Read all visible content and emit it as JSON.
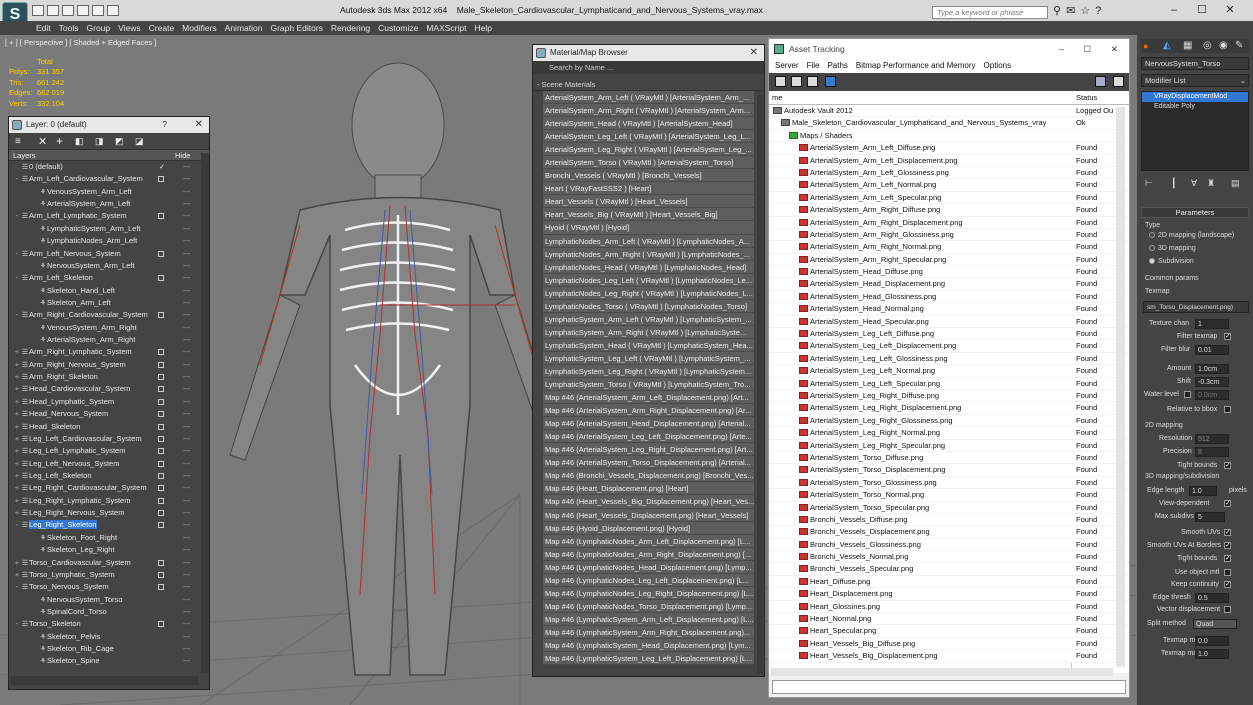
{
  "window": {
    "app_title": "Autodesk 3ds Max  2012 x64",
    "file_title": "Male_Skeleton_Cardiovascular_Lymphaticand_and_Nervous_Systems_vray.max",
    "search_placeholder": "Type a keyword or phrase",
    "logo_letter": "S"
  },
  "menu": [
    "Edit",
    "Tools",
    "Group",
    "Views",
    "Create",
    "Modifiers",
    "Animation",
    "Graph Editors",
    "Rendering",
    "Customize",
    "MAXScript",
    "Help"
  ],
  "viewport": {
    "label": "[ + ] [ Perspective ] [ Shaded + Edged Faces ]",
    "stats_header": "Total",
    "stats": [
      {
        "label": "Polys:",
        "value": "331 357"
      },
      {
        "label": "Tris:",
        "value": "661 242"
      },
      {
        "label": "Edges:",
        "value": "662 019"
      },
      {
        "label": "Verts:",
        "value": "332 104"
      }
    ]
  },
  "layer_panel": {
    "title": "Layer: 0 (default)",
    "help": "?",
    "col_layers": "Layers",
    "col_hide": "Hide",
    "rows": [
      {
        "label": "0 (default)",
        "indent": 0,
        "check": true,
        "box": false,
        "sel": false,
        "exp": ""
      },
      {
        "label": "Arm_Left_Cardiovascular_System",
        "indent": 0,
        "box": true,
        "exp": "-"
      },
      {
        "label": "VenousSystem_Arm_Left",
        "indent": 1
      },
      {
        "label": "ArterialSystem_Arm_Left",
        "indent": 1
      },
      {
        "label": "Arm_Left_Lymphatic_System",
        "indent": 0,
        "box": true,
        "exp": "-"
      },
      {
        "label": "LymphaticSystem_Arm_Left",
        "indent": 1
      },
      {
        "label": "LymphaticNodes_Arm_Left",
        "indent": 1
      },
      {
        "label": "Arm_Left_Nervous_System",
        "indent": 0,
        "box": true,
        "exp": "-"
      },
      {
        "label": "NervousSystem_Arm_Left",
        "indent": 1
      },
      {
        "label": "Arm_Left_Skeleton",
        "indent": 0,
        "box": true,
        "exp": "-"
      },
      {
        "label": "Skeleton_Hand_Left",
        "indent": 1
      },
      {
        "label": "Skeleton_Arm_Left",
        "indent": 1
      },
      {
        "label": "Arm_Right_Cardiovascular_System",
        "indent": 0,
        "box": true,
        "exp": "-"
      },
      {
        "label": "VenousSystem_Arm_Right",
        "indent": 1
      },
      {
        "label": "ArterialSystem_Arm_Right",
        "indent": 1
      },
      {
        "label": "Arm_Right_Lymphatic_System",
        "indent": 0,
        "box": true,
        "exp": "+"
      },
      {
        "label": "Arm_Right_Nervous_System",
        "indent": 0,
        "box": true,
        "exp": "+"
      },
      {
        "label": "Arm_Right_Skeleton",
        "indent": 0,
        "box": true,
        "exp": "+"
      },
      {
        "label": "Head_Cardiovascular_System",
        "indent": 0,
        "box": true,
        "exp": "+"
      },
      {
        "label": "Head_Lymphatic_System",
        "indent": 0,
        "box": true,
        "exp": "+"
      },
      {
        "label": "Head_Nervous_System",
        "indent": 0,
        "box": true,
        "exp": "+"
      },
      {
        "label": "Head_Skeleton",
        "indent": 0,
        "box": true,
        "exp": "+"
      },
      {
        "label": "Leg_Left_Cardiovascular_System",
        "indent": 0,
        "box": true,
        "exp": "+"
      },
      {
        "label": "Leg_Left_Lymphatic_System",
        "indent": 0,
        "box": true,
        "exp": "+"
      },
      {
        "label": "Leg_Left_Nervous_System",
        "indent": 0,
        "box": true,
        "exp": "+"
      },
      {
        "label": "Leg_Left_Skeleton",
        "indent": 0,
        "box": true,
        "exp": "+"
      },
      {
        "label": "Leg_Right_Cardiovascular_System",
        "indent": 0,
        "box": true,
        "exp": "+"
      },
      {
        "label": "Leg_Right_Lymphatic_System",
        "indent": 0,
        "box": true,
        "exp": "+"
      },
      {
        "label": "Leg_Right_Nervous_System",
        "indent": 0,
        "box": true,
        "exp": "+"
      },
      {
        "label": "Leg_Right_Skeleton",
        "indent": 0,
        "box": true,
        "exp": "-",
        "sel": true
      },
      {
        "label": "Skeleton_Foot_Right",
        "indent": 1
      },
      {
        "label": "Skeleton_Leg_Right",
        "indent": 1
      },
      {
        "label": "Torso_Cardiovascular_System",
        "indent": 0,
        "box": true,
        "exp": "+"
      },
      {
        "label": "Torso_Lymphatic_System",
        "indent": 0,
        "box": true,
        "exp": "+"
      },
      {
        "label": "Torso_Nervous_System",
        "indent": 0,
        "box": true,
        "exp": "-"
      },
      {
        "label": "NervousSystem_Torso",
        "indent": 1
      },
      {
        "label": "SpinalCord_Torso",
        "indent": 1
      },
      {
        "label": "Torso_Skeleton",
        "indent": 0,
        "box": true,
        "exp": "-"
      },
      {
        "label": "Skeleton_Pelvis",
        "indent": 1
      },
      {
        "label": "Skeleton_Rib_Cage",
        "indent": 1
      },
      {
        "label": "Skeleton_Spine",
        "indent": 1
      }
    ]
  },
  "material_browser": {
    "title": "Material/Map Browser",
    "search_placeholder": "Search by Name ...",
    "section": "- Scene Materials",
    "items": [
      "ArterialSystem_Arm_Left  ( VRayMtl ) [ArterialSystem_Arm_...",
      "ArterialSystem_Arm_Right  ( VRayMtl ) [ArterialSystem_Arm...",
      "ArterialSystem_Head  ( VRayMtl ) [ArterialSystem_Head]",
      "ArterialSystem_Leg_Left  ( VRayMtl ) [ArterialSystem_Leg_L...",
      "ArterialSystem_Leg_Right  ( VRayMtl ) [ArterialSystem_Leg_...",
      "ArterialSystem_Torso  ( VRayMtl ) [ArterialSystem_Torso]",
      "Bronchi_Vessels  ( VRayMtl ) [Bronchi_Vessels]",
      "Heart  ( VRayFastSSS2 ) [Heart]",
      "Heart_Vessels  ( VRayMtl ) [Heart_Vessels]",
      "Heart_Vessels_Big  ( VRayMtl ) [Heart_Vessels_Big]",
      "Hyoid  ( VRayMtl ) [Hyoid]",
      "LymphaticNodes_Arm_Left  ( VRayMtl ) [LymphaticNodes_A...",
      "LymphaticNodes_Arm_Right  ( VRayMtl ) [LymphaticNodes_...",
      "LymphaticNodes_Head  ( VRayMtl ) [LymphaticNodes_Head]",
      "LymphaticNodes_Leg_Left  ( VRayMtl ) [LymphaticNodes_Le...",
      "LymphaticNodes_Leg_Right  ( VRayMtl ) [LymphaticNodes_L...",
      "LymphaticNodes_Torso  ( VRayMtl ) [LymphaticNodes_Torso]",
      "LymphaticSystem_Arm_Left  ( VRayMtl ) [LymphaticSystem_...",
      "LymphaticSystem_Arm_Right  ( VRayMtl ) [LymphaticSyste...",
      "LymphaticSystem_Head  ( VRayMtl ) [LymphaticSystem_Hea...",
      "LymphaticSystem_Leg_Left  ( VRayMtl ) [LymphaticSystem_...",
      "LymphaticSystem_Leg_Right  ( VRayMtl ) [LymphaticSystem...",
      "LymphaticSystem_Torso  ( VRayMtl ) [LymphaticSystem_Tro...",
      "Map #46 (ArterialSystem_Arm_Left_Displacement.png) [Art...",
      "Map #46 (ArterialSystem_Arm_Right_Displacement.png) [Ar...",
      "Map #46 (ArterialSystem_Head_Displacement.png) [Arterial...",
      "Map #46 (ArterialSystem_Leg_Left_Displacement.png) [Arte...",
      "Map #46 (ArterialSystem_Leg_Right_Displacement.png) [Art...",
      "Map #46 (ArterialSystem_Torso_Displacement.png) [Arterial...",
      "Map #46 (Bronchi_Vessels_Displacement.png) [Bronchi_Ves...",
      "Map #46 (Heart_Displacement.png) [Heart]",
      "Map #46 (Heart_Vessels_Big_Displacement.png) [Heart_Ves...",
      "Map #46 (Heart_Vessels_Displacement.png) [Heart_Vessels]",
      "Map #46 (Hyoid_Displacement.png) [Hyoid]",
      "Map #46 (LymphaticNodes_Arm_Left_Displacement.png) [L...",
      "Map #46 (LymphaticNodes_Arm_Right_Displacement.png) [...",
      "Map #46 (LymphaticNodes_Head_Displacement.png) [Lymp...",
      "Map #46 (LymphaticNodes_Leg_Left_Displacement.png) [L...",
      "Map #46 (LymphaticNodes_Leg_Right_Displacement.png) [L...",
      "Map #46 (LymphaticNodes_Torso_Displacement.png) [Lymp...",
      "Map #46 (LymphaticSystem_Arm_Left_Displacement.png) [L...",
      "Map #46 (LymphaticSystem_Arm_Right_Displacement.png)...",
      "Map #46 (LymphaticSystem_Head_Displacement.png) [Lym...",
      "Map #46 (LymphaticSystem_Leg_Left_Displacement.png) [L..."
    ]
  },
  "asset_tracking": {
    "title": "Asset Tracking",
    "menu": [
      "Server",
      "File",
      "Paths",
      "Bitmap Performance and Memory",
      "Options"
    ],
    "col_name": "me",
    "col_status": "Status",
    "rows": [
      {
        "name": "Autodesk Vault 2012",
        "status": "Logged Ou",
        "level": 0,
        "kind": "vault"
      },
      {
        "name": "Male_Skeleton_Cardiovascular_Lymphaticand_and_Nervous_Systems_vray.max",
        "status": "Ok",
        "level": 1,
        "kind": "max"
      },
      {
        "name": "Maps / Shaders",
        "status": "",
        "level": 2,
        "kind": "folder"
      },
      {
        "name": "ArterialSystem_Arm_Left_Diffuse.png",
        "status": "Found",
        "level": 3,
        "kind": "file"
      },
      {
        "name": "ArterialSystem_Arm_Left_Displacement.png",
        "status": "Found",
        "level": 3,
        "kind": "file"
      },
      {
        "name": "ArterialSystem_Arm_Left_Glossiness.png",
        "status": "Found",
        "level": 3,
        "kind": "file"
      },
      {
        "name": "ArterialSystem_Arm_Left_Normal.png",
        "status": "Found",
        "level": 3,
        "kind": "file"
      },
      {
        "name": "ArterialSystem_Arm_Left_Specular.png",
        "status": "Found",
        "level": 3,
        "kind": "file"
      },
      {
        "name": "ArterialSystem_Arm_Right_Diffuse.png",
        "status": "Found",
        "level": 3,
        "kind": "file"
      },
      {
        "name": "ArterialSystem_Arm_Right_Displacement.png",
        "status": "Found",
        "level": 3,
        "kind": "file"
      },
      {
        "name": "ArterialSystem_Arm_Right_Glossiness.png",
        "status": "Found",
        "level": 3,
        "kind": "file"
      },
      {
        "name": "ArterialSystem_Arm_Right_Normal.png",
        "status": "Found",
        "level": 3,
        "kind": "file"
      },
      {
        "name": "ArterialSystem_Arm_Right_Specular.png",
        "status": "Found",
        "level": 3,
        "kind": "file"
      },
      {
        "name": "ArterialSystem_Head_Diffuse.png",
        "status": "Found",
        "level": 3,
        "kind": "file"
      },
      {
        "name": "ArterialSystem_Head_Displacement.png",
        "status": "Found",
        "level": 3,
        "kind": "file"
      },
      {
        "name": "ArterialSystem_Head_Glossiness.png",
        "status": "Found",
        "level": 3,
        "kind": "file"
      },
      {
        "name": "ArterialSystem_Head_Normal.png",
        "status": "Found",
        "level": 3,
        "kind": "file"
      },
      {
        "name": "ArterialSystem_Head_Specular.png",
        "status": "Found",
        "level": 3,
        "kind": "file"
      },
      {
        "name": "ArterialSystem_Leg_Left_Diffuse.png",
        "status": "Found",
        "level": 3,
        "kind": "file"
      },
      {
        "name": "ArterialSystem_Leg_Left_Displacement.png",
        "status": "Found",
        "level": 3,
        "kind": "file"
      },
      {
        "name": "ArterialSystem_Leg_Left_Glossiness.png",
        "status": "Found",
        "level": 3,
        "kind": "file"
      },
      {
        "name": "ArterialSystem_Leg_Left_Normal.png",
        "status": "Found",
        "level": 3,
        "kind": "file"
      },
      {
        "name": "ArterialSystem_Leg_Left_Specular.png",
        "status": "Found",
        "level": 3,
        "kind": "file"
      },
      {
        "name": "ArterialSystem_Leg_Right_Diffuse.png",
        "status": "Found",
        "level": 3,
        "kind": "file"
      },
      {
        "name": "ArterialSystem_Leg_Right_Displacement.png",
        "status": "Found",
        "level": 3,
        "kind": "file"
      },
      {
        "name": "ArterialSystem_Leg_Right_Glossiness.png",
        "status": "Found",
        "level": 3,
        "kind": "file"
      },
      {
        "name": "ArterialSystem_Leg_Right_Normal.png",
        "status": "Found",
        "level": 3,
        "kind": "file"
      },
      {
        "name": "ArterialSystem_Leg_Right_Specular.png",
        "status": "Found",
        "level": 3,
        "kind": "file"
      },
      {
        "name": "ArterialSystem_Torso_Diffuse.png",
        "status": "Found",
        "level": 3,
        "kind": "file"
      },
      {
        "name": "ArterialSystem_Torso_Displacement.png",
        "status": "Found",
        "level": 3,
        "kind": "file"
      },
      {
        "name": "ArterialSystem_Torso_Glossiness.png",
        "status": "Found",
        "level": 3,
        "kind": "file"
      },
      {
        "name": "ArterialSystem_Torso_Normal.png",
        "status": "Found",
        "level": 3,
        "kind": "file"
      },
      {
        "name": "ArterialSystem_Torso_Specular.png",
        "status": "Found",
        "level": 3,
        "kind": "file"
      },
      {
        "name": "Bronchi_Vessels_Diffuse.png",
        "status": "Found",
        "level": 3,
        "kind": "file"
      },
      {
        "name": "Bronchi_Vessels_Displacement.png",
        "status": "Found",
        "level": 3,
        "kind": "file"
      },
      {
        "name": "Bronchi_Vessels_Glossiness.png",
        "status": "Found",
        "level": 3,
        "kind": "file"
      },
      {
        "name": "Bronchi_Vessels_Normal.png",
        "status": "Found",
        "level": 3,
        "kind": "file"
      },
      {
        "name": "Bronchi_Vessels_Specular.png",
        "status": "Found",
        "level": 3,
        "kind": "file"
      },
      {
        "name": "Heart_Diffuse.png",
        "status": "Found",
        "level": 3,
        "kind": "file"
      },
      {
        "name": "Heart_Displacement.png",
        "status": "Found",
        "level": 3,
        "kind": "file"
      },
      {
        "name": "Heart_Glossines.png",
        "status": "Found",
        "level": 3,
        "kind": "file"
      },
      {
        "name": "Heart_Normal.png",
        "status": "Found",
        "level": 3,
        "kind": "file"
      },
      {
        "name": "Heart_Specular.png",
        "status": "Found",
        "level": 3,
        "kind": "file"
      },
      {
        "name": "Heart_Vessels_Big_Diffuse.png",
        "status": "Found",
        "level": 3,
        "kind": "file"
      },
      {
        "name": "Heart_Vessels_Big_Displacement.png",
        "status": "Found",
        "level": 3,
        "kind": "file"
      }
    ]
  },
  "command_panel": {
    "object_name": "NervousSystem_Torso",
    "modifier_list": "Modifier List",
    "stack": [
      "VRayDisplacementMod",
      "Editable Poly"
    ],
    "rollout_title": "Parameters",
    "type_label": "Type",
    "type_options": [
      "2D mapping (landscape)",
      "3D mapping",
      "Subdivision"
    ],
    "type_selected": 2,
    "common_params": "Common params",
    "texmap_label": "Texmap",
    "texmap_value": "sm_Torso_Displacement.png)",
    "texture_chan_label": "Texture chan",
    "texture_chan_value": "1",
    "filter_texmap_label": "Filter texmap",
    "filter_blur_label": "Filter blur",
    "filter_blur_value": "0.01",
    "amount_label": "Amount",
    "amount_value": "1.0cm",
    "shift_label": "Shift",
    "shift_value": "-0.3cm",
    "water_level_label": "Water level",
    "water_level_value": "0.0cm",
    "relative_bbox_label": "Relative to bbox",
    "map2d_title": "2D mapping",
    "resolution_label": "Resolution",
    "resolution_value": "512",
    "precision_label": "Precision",
    "precision_value": "8",
    "tight_bounds_label": "Tight bounds",
    "subdiv_title": "3D mapping/subdivision",
    "edge_length_label": "Edge length",
    "edge_length_value": "1.0",
    "pixels_label": "pixels",
    "view_dependent_label": "View-dependent",
    "max_subdivs_label": "Max subdivs",
    "max_subdivs_value": "5",
    "smooth_uvs_label": "Smooth UVs",
    "smooth_uvs_borders_label": "Smooth UVs At Borders",
    "tight_bounds2_label": "Tight bounds",
    "use_object_mtl_label": "Use object mtl",
    "keep_continuity_label": "Keep continuity",
    "edge_thresh_label": "Edge thresh",
    "edge_thresh_value": "0.5",
    "vector_disp_label": "Vector displacement",
    "split_method_label": "Split method",
    "split_method_value": "Quad",
    "texmap_min_label": "Texmap min",
    "texmap_min_value": "0.0",
    "texmap_max_label": "Texmap max",
    "texmap_max_value": "1.0"
  }
}
